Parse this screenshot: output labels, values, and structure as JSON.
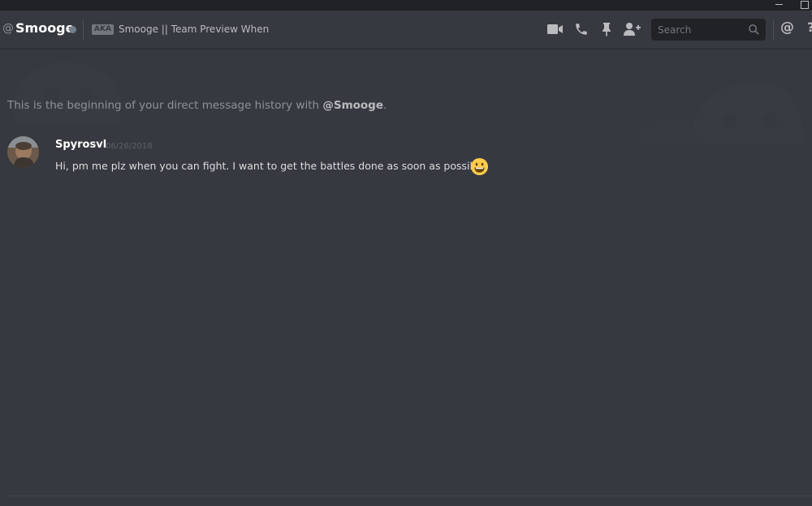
{
  "header": {
    "at_symbol": "@",
    "dm_name": "Smooge",
    "aka_badge": "AKA",
    "aka_text": "Smooge || Team Preview When",
    "search_placeholder": "Search",
    "mention_symbol": "@"
  },
  "main": {
    "intro_prefix": "This is the beginning of your direct message history with ",
    "intro_user": "@Smooge",
    "intro_suffix": "."
  },
  "messages": [
    {
      "author": "Spyrosvl",
      "timestamp": "06/26/2018",
      "text": "Hi, pm me plz when you can fight. I want to get the battles done as soon as possible"
    }
  ],
  "colors": {
    "background": "#36393f",
    "titlebar": "#202225",
    "status_offline": "#747f8d",
    "emoji_yellow": "#ffcc4d"
  },
  "icons": [
    "video-call-icon",
    "voice-call-icon",
    "pin-icon",
    "add-friend-icon",
    "search-icon",
    "mention-icon",
    "help-icon",
    "smiley-emoji"
  ]
}
